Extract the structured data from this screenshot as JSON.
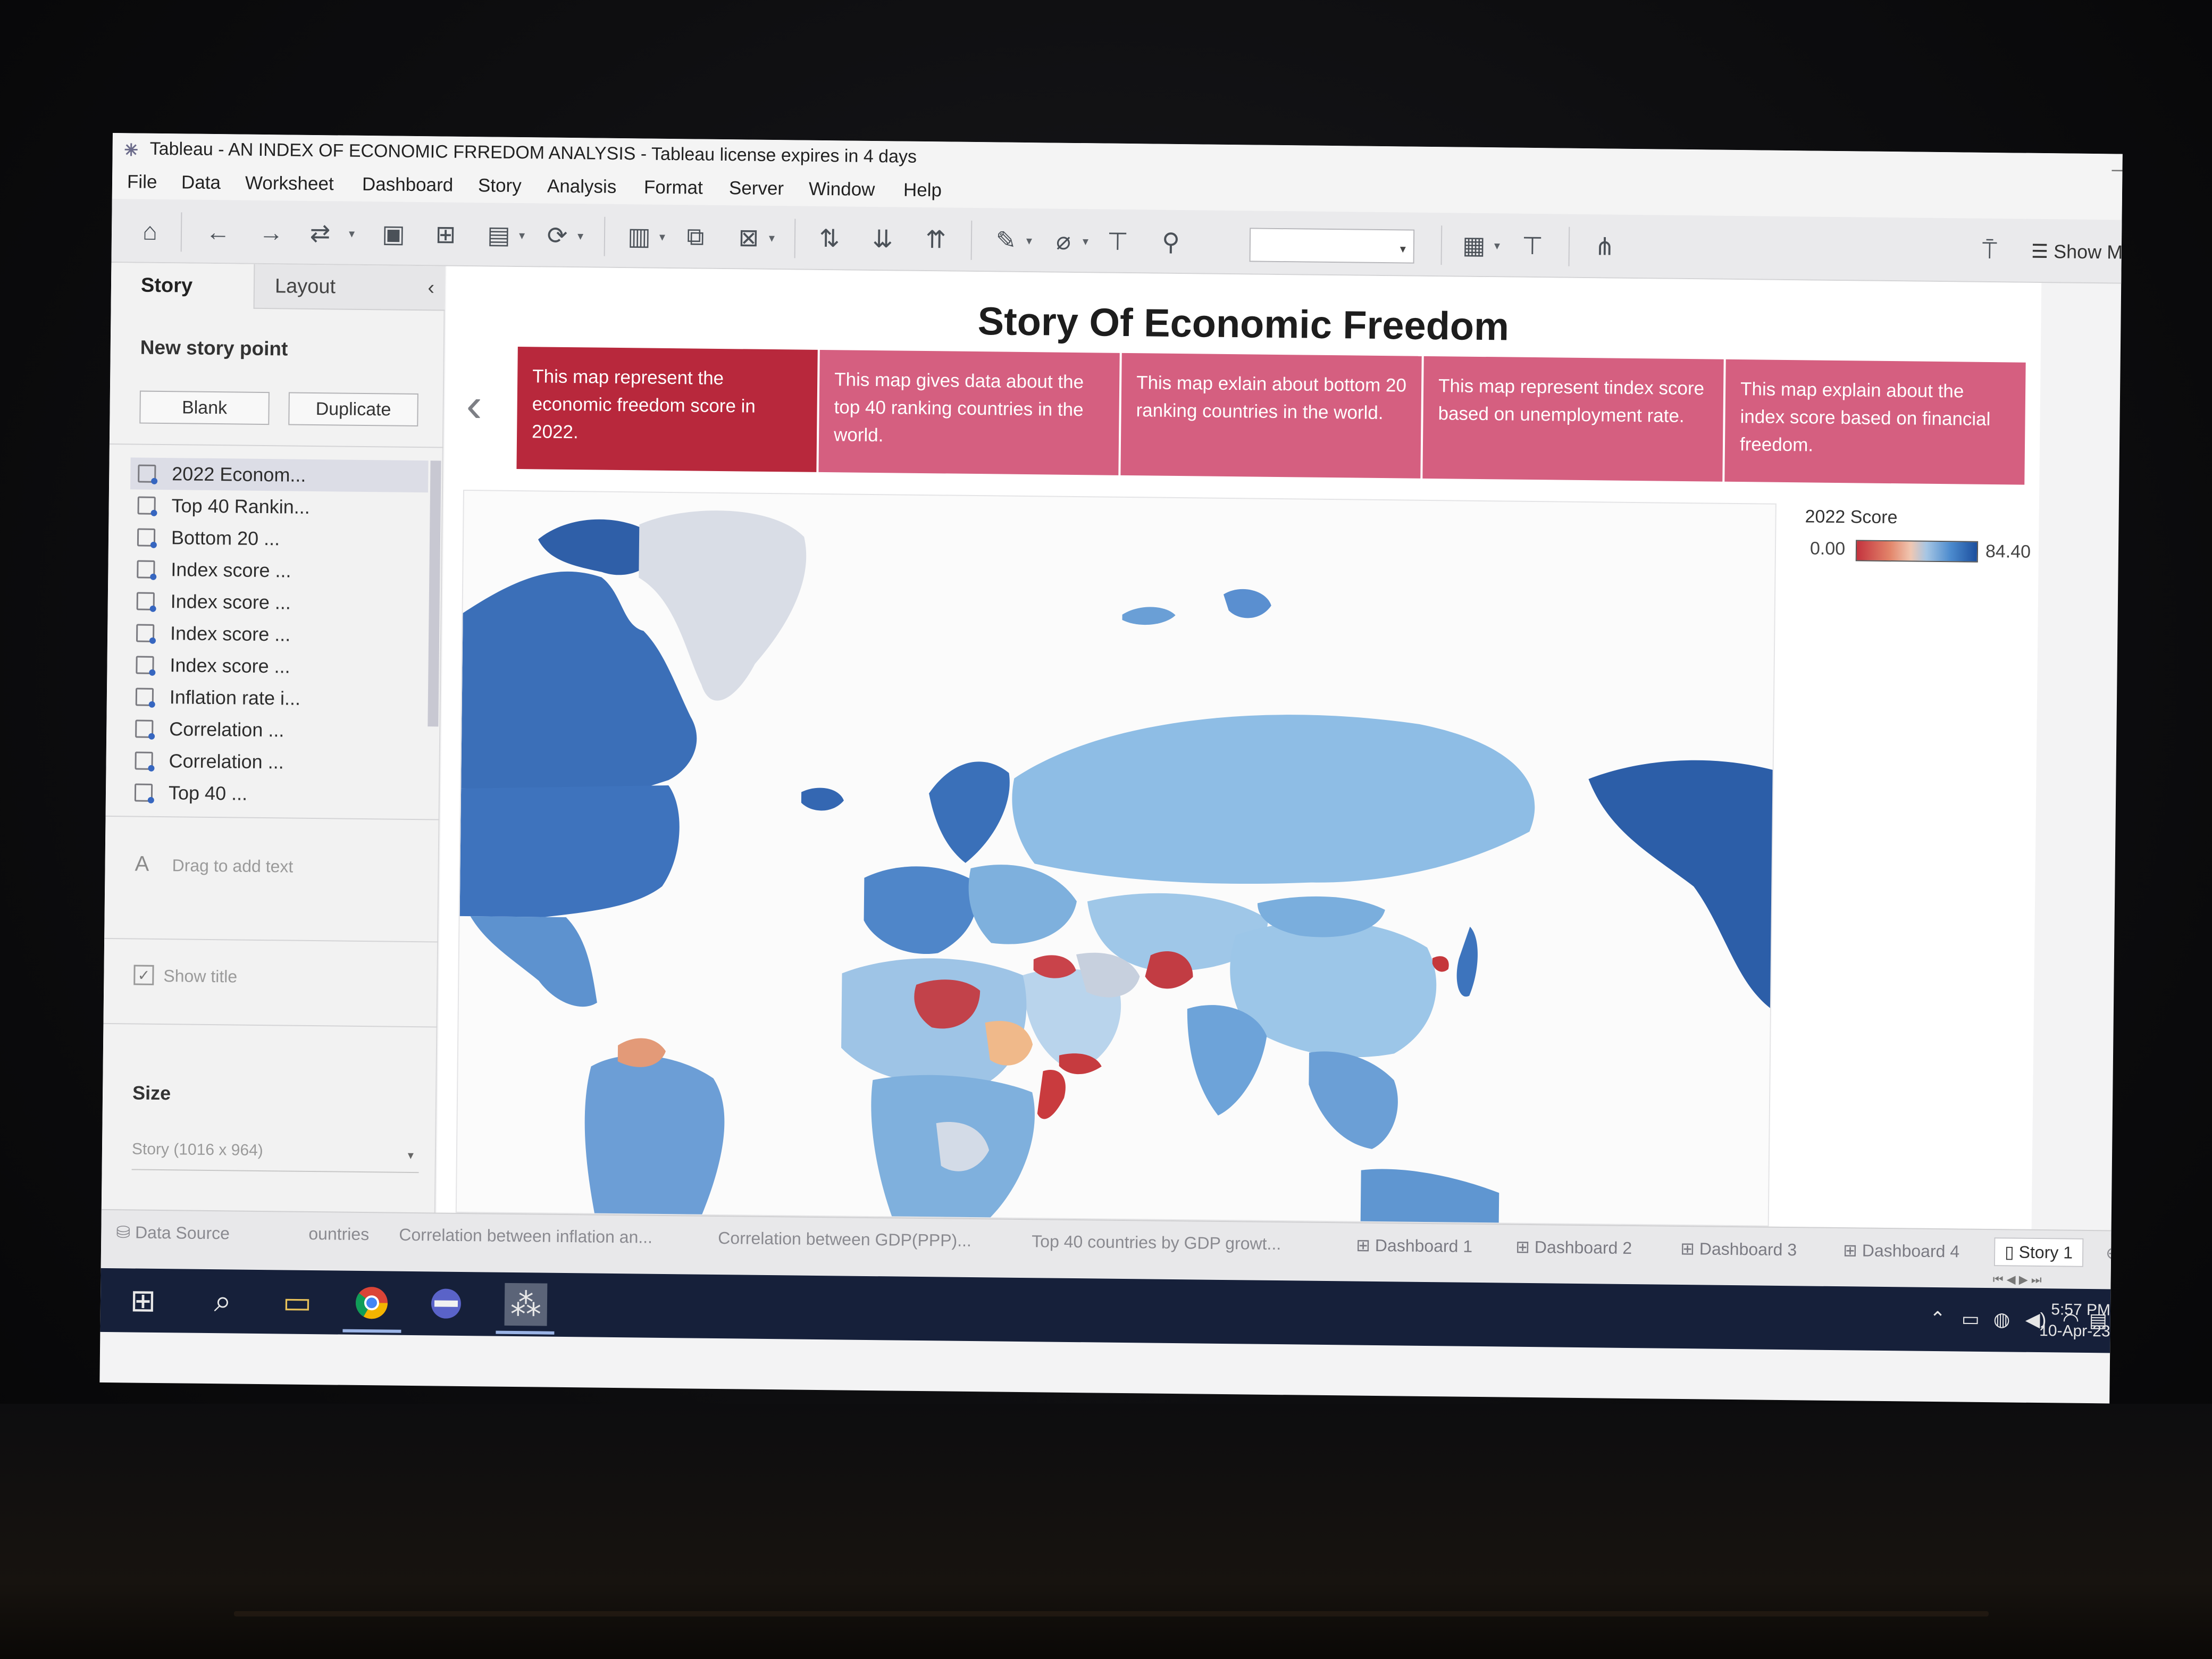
{
  "window": {
    "title": "Tableau - AN INDEX OF ECONOMIC FRREDOM ANALYSIS - Tableau license expires in 4 days"
  },
  "menu": [
    "File",
    "Data",
    "Worksheet",
    "Dashboard",
    "Story",
    "Analysis",
    "Format",
    "Server",
    "Window",
    "Help"
  ],
  "toolbar": {
    "show_me_label": "Show M"
  },
  "left_pane": {
    "tabs": {
      "story": "Story",
      "layout": "Layout"
    },
    "new_story_point": "New story point",
    "blank_button": "Blank",
    "duplicate_button": "Duplicate",
    "sheets": [
      "2022 Econom...",
      "Top 40 Rankin...",
      "Bottom 20 ...",
      "Index score ...",
      "Index score ...",
      "Index score ...",
      "Index score ...",
      "Inflation rate i...",
      "Correlation ...",
      "Correlation ...",
      "Top 40 ..."
    ],
    "drag_text": "Drag to add text",
    "show_title": "Show title",
    "size_heading": "Size",
    "size_value": "Story (1016 x 964)"
  },
  "story": {
    "title": "Story Of Economic Freedom",
    "points": [
      "This map represent the economic freedom score in 2022.",
      "This map gives data about the top 40 ranking countries in the world.",
      "This map exlain about bottom 20 ranking countries in the world.",
      "This map represent tindex score based on unemployment rate.",
      "This map explain about the index score based on financial freedom."
    ],
    "active_point": 0
  },
  "legend": {
    "title": "2022 Score",
    "min": "0.00",
    "max": "84.40"
  },
  "bottom_tabs": {
    "data_source": "Data Source",
    "sheets": [
      "ountries",
      "Correlation between inflation an...",
      "Correlation between GDP(PPP)...",
      "Top 40 countries by GDP growt..."
    ],
    "dashboards": [
      "Dashboard 1",
      "Dashboard 2",
      "Dashboard 3",
      "Dashboard 4"
    ],
    "active_story": "Story 1"
  },
  "taskbar": {
    "time": "5:57 PM",
    "date": "10-Apr-23"
  }
}
